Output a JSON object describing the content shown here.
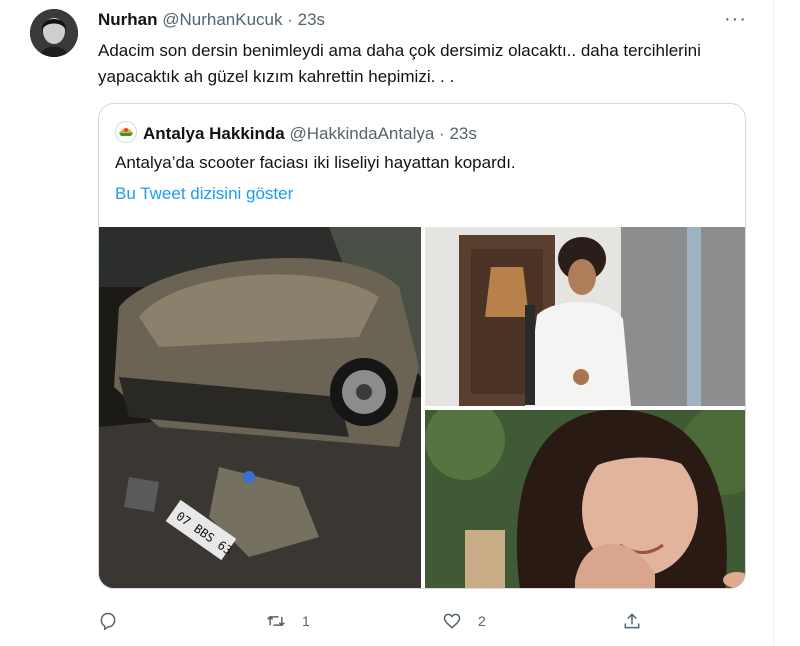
{
  "tweet": {
    "author_name": "Nurhan",
    "author_handle": "@NurhanKucuk",
    "separator": "·",
    "time": "23s",
    "text": "Adacim son dersin benimleydi ama daha çok dersimiz olacaktı.. daha tercihlerini yapacaktık ah güzel kızım kahrettin hepimizi.   .   ."
  },
  "quote": {
    "author_name": "Antalya Hakkinda",
    "author_handle": "@HakkindaAntalya",
    "separator": "·",
    "time": "23s",
    "text": "Antalya’da scooter faciası iki liseliyi hayattan kopardı.",
    "thread_link": "Bu Tweet dizisini göster",
    "plate_text": "07 BBS 63"
  },
  "actions": {
    "reply_icon": "reply-icon",
    "retweet_icon": "retweet-icon",
    "retweet_count": "1",
    "like_icon": "heart-icon",
    "like_count": "2",
    "share_icon": "share-icon"
  },
  "colors": {
    "link": "#1d9bf0",
    "muted": "#536471",
    "border": "#cfd9de"
  }
}
